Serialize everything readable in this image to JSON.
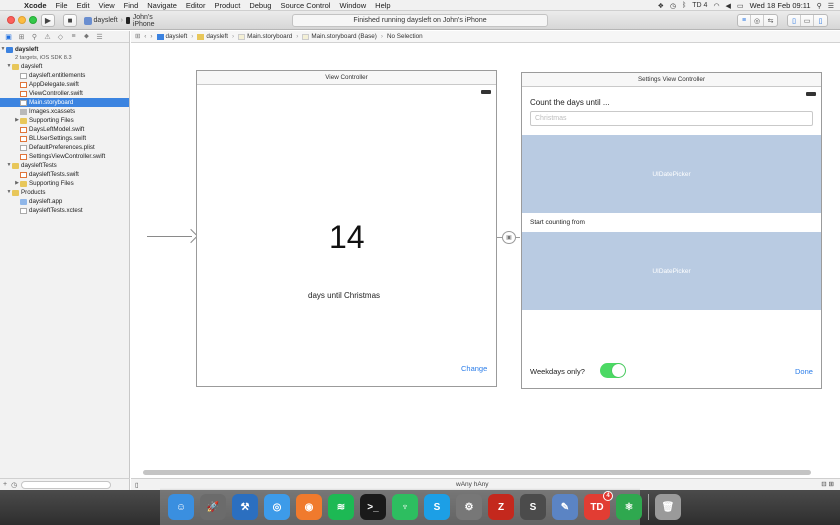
{
  "menubar": {
    "app_name": "Xcode",
    "items": [
      "File",
      "Edit",
      "View",
      "Find",
      "Navigate",
      "Editor",
      "Product",
      "Debug",
      "Source Control",
      "Window",
      "Help"
    ],
    "clock": "Wed 18 Feb  09:11",
    "status_icons": [
      "dropbox-icon",
      "time-machine-icon",
      "bluetooth-icon",
      "wifi-icon",
      "volume-icon",
      "battery-icon",
      "spotlight-icon",
      "notification-icon"
    ],
    "battery_label": "TD 4"
  },
  "toolbar": {
    "scheme": "daysleft",
    "destination": "John's iPhone",
    "activity": "Finished running daysleft on John's iPhone"
  },
  "navigator": {
    "project_name": "daysleft",
    "project_sub": "2 targets, iOS SDK 8.3",
    "items": [
      {
        "label": "daysleft",
        "kind": "folder",
        "depth": 1,
        "open": true
      },
      {
        "label": "daysleft.entitlements",
        "kind": "file",
        "depth": 2
      },
      {
        "label": "AppDelegate.swift",
        "kind": "swift",
        "depth": 2
      },
      {
        "label": "ViewController.swift",
        "kind": "swift",
        "depth": 2
      },
      {
        "label": "Main.storyboard",
        "kind": "file",
        "depth": 2,
        "selected": true
      },
      {
        "label": "Images.xcassets",
        "kind": "img",
        "depth": 2
      },
      {
        "label": "Supporting Files",
        "kind": "folder",
        "depth": 2,
        "open": false
      },
      {
        "label": "DaysLeftModel.swift",
        "kind": "swift",
        "depth": 2
      },
      {
        "label": "BLUserSettings.swift",
        "kind": "swift",
        "depth": 2
      },
      {
        "label": "DefaultPreferences.plist",
        "kind": "file",
        "depth": 2
      },
      {
        "label": "SettingsViewController.swift",
        "kind": "swift",
        "depth": 2
      },
      {
        "label": "daysleftTests",
        "kind": "folder",
        "depth": 1,
        "open": true
      },
      {
        "label": "daysleftTests.swift",
        "kind": "swift",
        "depth": 2
      },
      {
        "label": "Supporting Files",
        "kind": "folder",
        "depth": 2,
        "open": false
      },
      {
        "label": "Products",
        "kind": "folder",
        "depth": 1,
        "open": true
      },
      {
        "label": "daysleft.app",
        "kind": "app",
        "depth": 2
      },
      {
        "label": "daysleftTests.xctest",
        "kind": "file",
        "depth": 2
      }
    ]
  },
  "jumpbar": {
    "crumbs": [
      "daysleft",
      "daysleft",
      "Main.storyboard",
      "Main.storyboard (Base)",
      "No Selection"
    ]
  },
  "storyboard": {
    "vc1": {
      "title": "View Controller",
      "number": "14",
      "subtitle": "days until Christmas",
      "change": "Change"
    },
    "vc2": {
      "title": "Settings View Controller",
      "heading": "Count the days until ...",
      "placeholder": "Christmas",
      "picker1": "UIDatePicker",
      "start_label": "Start counting from",
      "picker2": "UIDatePicker",
      "weekdays": "Weekdays only?",
      "weekdays_on": true,
      "done": "Done"
    }
  },
  "size_class": "wAny hAny",
  "dock": {
    "apps": [
      {
        "name": "finder-icon",
        "glyph": "☺",
        "color": "#3a8fe0"
      },
      {
        "name": "launchpad-icon",
        "glyph": "🚀",
        "color": "#6b6b6b"
      },
      {
        "name": "xcode-icon",
        "glyph": "⚒",
        "color": "#2b6fc0"
      },
      {
        "name": "safari-icon",
        "glyph": "◎",
        "color": "#3d9be9"
      },
      {
        "name": "vlc-icon",
        "glyph": "◉",
        "color": "#f07a2d"
      },
      {
        "name": "spotify-icon",
        "glyph": "≋",
        "color": "#1db954"
      },
      {
        "name": "terminal-icon",
        "glyph": ">_",
        "color": "#1a1a1a"
      },
      {
        "name": "evernote-icon",
        "glyph": "♆",
        "color": "#2dbe60"
      },
      {
        "name": "skype-icon",
        "glyph": "S",
        "color": "#1c9fe6"
      },
      {
        "name": "system-preferences-icon",
        "glyph": "⚙",
        "color": "#777777"
      },
      {
        "name": "filezilla-icon",
        "glyph": "Z",
        "color": "#c4281d"
      },
      {
        "name": "sublime-text-icon",
        "glyph": "S",
        "color": "#4b4b4b"
      },
      {
        "name": "preview-icon",
        "glyph": "✎",
        "color": "#5b84c4"
      },
      {
        "name": "todoist-icon",
        "glyph": "TD",
        "color": "#e23d33",
        "badge": "4"
      },
      {
        "name": "atom-icon",
        "glyph": "⚛",
        "color": "#2fa84f"
      }
    ],
    "trash": {
      "name": "trash-icon",
      "glyph": "🗑",
      "color": "#9a9a9a"
    }
  }
}
